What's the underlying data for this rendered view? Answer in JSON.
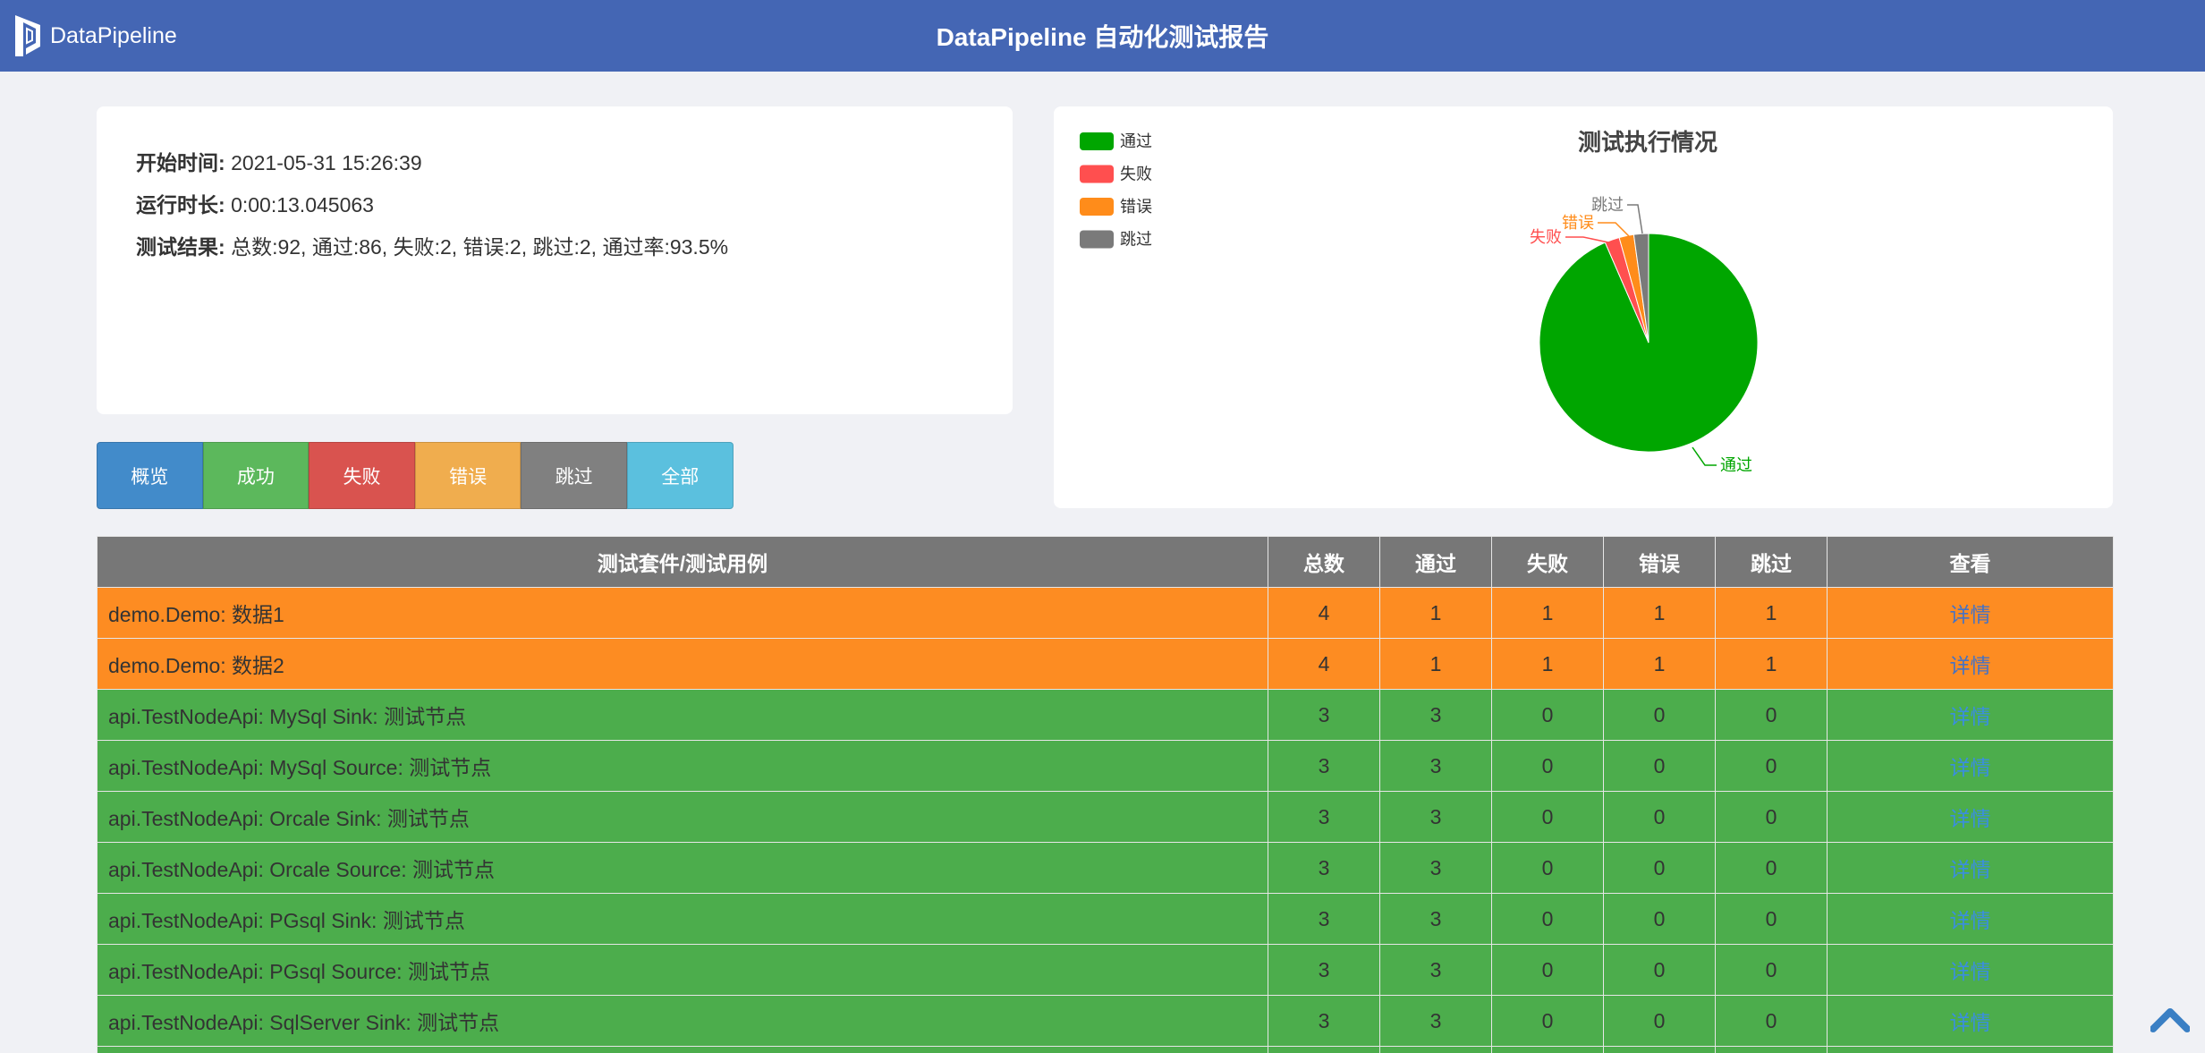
{
  "navbar": {
    "brand": "DataPipeline",
    "title": "DataPipeline 自动化测试报告"
  },
  "summary": {
    "start_label": "开始时间:",
    "start_value": "2021-05-31 15:26:39",
    "duration_label": "运行时长:",
    "duration_value": "0:00:13.045063",
    "result_label": "测试结果:",
    "result_value": "总数:92, 通过:86, 失败:2, 错误:2, 跳过:2, 通过率:93.5%"
  },
  "filters": [
    "概览",
    "成功",
    "失败",
    "错误",
    "跳过",
    "全部"
  ],
  "table": {
    "headers": [
      "测试套件/测试用例",
      "总数",
      "通过",
      "失败",
      "错误",
      "跳过",
      "查看"
    ],
    "rows": [
      {
        "name": "demo.Demo: 数据1",
        "total": "4",
        "pass": "1",
        "fail": "1",
        "error": "1",
        "skip": "1",
        "link": "详情",
        "status": "orange"
      },
      {
        "name": "demo.Demo: 数据2",
        "total": "4",
        "pass": "1",
        "fail": "1",
        "error": "1",
        "skip": "1",
        "link": "详情",
        "status": "orange"
      },
      {
        "name": "api.TestNodeApi: MySql Sink: 测试节点",
        "total": "3",
        "pass": "3",
        "fail": "0",
        "error": "0",
        "skip": "0",
        "link": "详情",
        "status": "green"
      },
      {
        "name": "api.TestNodeApi: MySql Source: 测试节点",
        "total": "3",
        "pass": "3",
        "fail": "0",
        "error": "0",
        "skip": "0",
        "link": "详情",
        "status": "green"
      },
      {
        "name": "api.TestNodeApi: Orcale Sink: 测试节点",
        "total": "3",
        "pass": "3",
        "fail": "0",
        "error": "0",
        "skip": "0",
        "link": "详情",
        "status": "green"
      },
      {
        "name": "api.TestNodeApi: Orcale Source: 测试节点",
        "total": "3",
        "pass": "3",
        "fail": "0",
        "error": "0",
        "skip": "0",
        "link": "详情",
        "status": "green"
      },
      {
        "name": "api.TestNodeApi: PGsql Sink: 测试节点",
        "total": "3",
        "pass": "3",
        "fail": "0",
        "error": "0",
        "skip": "0",
        "link": "详情",
        "status": "green"
      },
      {
        "name": "api.TestNodeApi: PGsql Source: 测试节点",
        "total": "3",
        "pass": "3",
        "fail": "0",
        "error": "0",
        "skip": "0",
        "link": "详情",
        "status": "green"
      },
      {
        "name": "api.TestNodeApi: SqlServer Sink: 测试节点",
        "total": "3",
        "pass": "3",
        "fail": "0",
        "error": "0",
        "skip": "0",
        "link": "详情",
        "status": "green"
      },
      {
        "name": "",
        "total": "",
        "pass": "",
        "fail": "",
        "error": "",
        "skip": "",
        "link": "",
        "status": "green"
      }
    ]
  },
  "chart_data": {
    "type": "pie",
    "title": "测试执行情况",
    "legend_position": "top-left",
    "categories": [
      "通过",
      "失败",
      "错误",
      "跳过"
    ],
    "values": [
      86,
      2,
      2,
      2
    ],
    "colors": [
      "#00a600",
      "#ff4f4f",
      "#ff8c1a",
      "#7a7a7a"
    ]
  },
  "icons": {
    "brand_logo": "datapipeline-logo-icon",
    "scroll_top": "chevron-up-icon"
  },
  "colors": {
    "navbar": "#4466b4",
    "row_partial": "#fd8c22",
    "row_pass": "#4cad4c",
    "header": "#777777"
  }
}
